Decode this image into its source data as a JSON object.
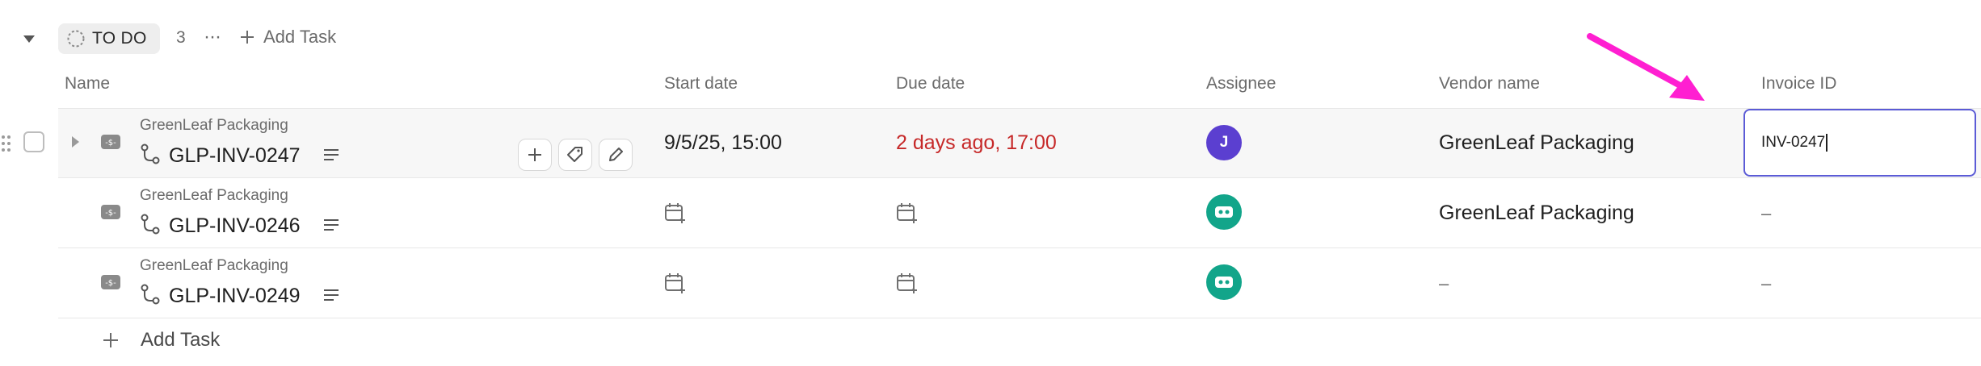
{
  "group": {
    "status_label": "TO DO",
    "count": "3",
    "more_label": "···",
    "add_task_label": "Add Task"
  },
  "columns": {
    "name": "Name",
    "start_date": "Start date",
    "due_date": "Due date",
    "assignee": "Assignee",
    "vendor_name": "Vendor name",
    "invoice_id": "Invoice ID"
  },
  "rows": [
    {
      "vendor": "GreenLeaf Packaging",
      "title": "GLP-INV-0247",
      "start_date": "9/5/25, 15:00",
      "due_date": "2 days ago, 17:00",
      "assignee_initial": "J",
      "vendor_name": "GreenLeaf Packaging",
      "invoice_id": "INV-0247"
    },
    {
      "vendor": "GreenLeaf Packaging",
      "title": "GLP-INV-0246",
      "vendor_name": "GreenLeaf Packaging",
      "invoice_id": "–"
    },
    {
      "vendor": "GreenLeaf Packaging",
      "title": "GLP-INV-0249",
      "vendor_name": "–",
      "invoice_id": "–"
    }
  ],
  "footer": {
    "add_task_label": "Add Task"
  },
  "colors": {
    "overdue": "#c62828",
    "assignee_j": "#5b3fd0",
    "assignee_bot": "#12a58a",
    "focus_border": "#5b5bd6",
    "annotation_arrow": "#ff1fd1"
  }
}
